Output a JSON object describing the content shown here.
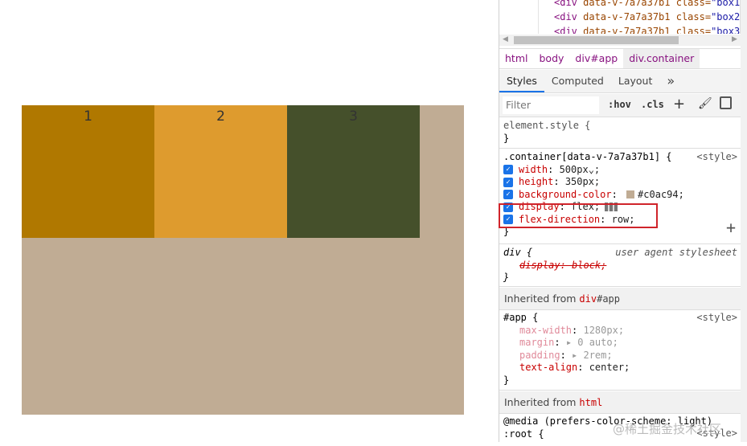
{
  "page": {
    "boxes": [
      {
        "label": "1",
        "color": "#b07800"
      },
      {
        "label": "2",
        "color": "#de9b2e"
      },
      {
        "label": "3",
        "color": "#45502b"
      }
    ],
    "container_color": "#c0ac94"
  },
  "devtools": {
    "code_lines": [
      {
        "tag": "<div",
        "attr": " data-v-7a7a37b1",
        "cls": " class=",
        "val": "\"box1\""
      },
      {
        "tag": "<div",
        "attr": " data-v-7a7a37b1",
        "cls": " class=",
        "val": "\"box2\""
      },
      {
        "tag": "<div",
        "attr": " data-v-7a7a37b1",
        "cls": " class=",
        "val": "\"box3\""
      }
    ],
    "breadcrumbs": [
      "html",
      "body",
      "div#app",
      "div.container"
    ],
    "tabs": [
      "Styles",
      "Computed",
      "Layout",
      "»"
    ],
    "filter_placeholder": "Filter",
    "hov": ":hov",
    "cls": ".cls",
    "element_style": "element.style {",
    "close": "}",
    "rule1": {
      "selector": ".container[data-v-7a7a37b1] {",
      "source": "<style>",
      "props": [
        {
          "name": "width",
          "value": "500px⌄;"
        },
        {
          "name": "height",
          "value": "350px;"
        },
        {
          "name": "background-color",
          "value": "#c0ac94;"
        },
        {
          "name": "display",
          "value": "flex;"
        },
        {
          "name": "flex-direction",
          "value": "row;"
        }
      ]
    },
    "rule2": {
      "selector": "div {",
      "source": "user agent stylesheet",
      "prop": "display: block;"
    },
    "inherited1": {
      "label": "Inherited from",
      "tag": "div",
      "rest": "#app"
    },
    "rule3": {
      "selector": "#app {",
      "source": "<style>",
      "props": [
        {
          "name": "max-width",
          "value": "1280px;"
        },
        {
          "name": "margin",
          "value": "▸ 0 auto;"
        },
        {
          "name": "padding",
          "value": "▸ 2rem;"
        },
        {
          "name": "text-align",
          "value": "center;"
        }
      ]
    },
    "inherited2": {
      "label": "Inherited from",
      "tag": "html"
    },
    "rule4": {
      "media": "@media (prefers-color-scheme: light)",
      "selector": ":root {",
      "source": "<style>"
    },
    "watermark": "@稀土掘金技术社区"
  }
}
